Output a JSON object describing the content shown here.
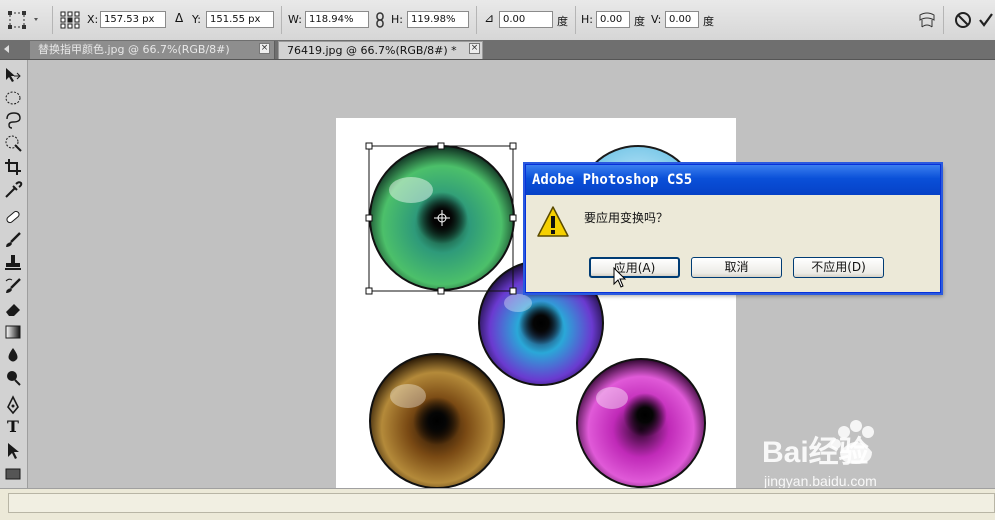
{
  "options": {
    "x_label": "X:",
    "x_value": "157.53 px",
    "y_label": "Y:",
    "y_value": "151.55 px",
    "w_label": "W:",
    "w_value": "118.94%",
    "h_label": "H:",
    "h_value": "119.98%",
    "angle_value": "0.00",
    "angle_unit": "度",
    "skew_h_label": "H:",
    "skew_h_value": "0.00",
    "skew_h_unit": "度",
    "skew_v_label": "V:",
    "skew_v_value": "0.00",
    "skew_v_unit": "度"
  },
  "tabs": [
    {
      "label": "替换指甲颜色.jpg @ 66.7%(RGB/8#)",
      "active": false
    },
    {
      "label": "76419.jpg @ 66.7%(RGB/8#) *",
      "active": true
    }
  ],
  "tools": [
    "move-tool",
    "marquee-tool",
    "lasso-tool",
    "quick-selection-tool",
    "crop-tool",
    "eyedropper-tool",
    "healing-brush-tool",
    "brush-tool",
    "clone-stamp-tool",
    "history-brush-tool",
    "eraser-tool",
    "gradient-tool",
    "blur-tool",
    "dodge-tool",
    "pen-tool",
    "type-tool",
    "path-selection-tool",
    "rectangle-tool"
  ],
  "dialog": {
    "title": "Adobe Photoshop CS5",
    "message": "要应用变换吗？",
    "buttons": {
      "apply": "应用(A)",
      "cancel": "取消",
      "dont_apply": "不应用(D)"
    }
  },
  "watermark": {
    "text": "Bai经验",
    "url": "jingyan.baidu.com"
  },
  "colors": {
    "dialog_title_bg": "#0a50d8",
    "dialog_bg": "#ece9d8",
    "eye_green": "#3aa26a",
    "eye_purple": "#5b3aa8",
    "eye_brown": "#8a5a1a",
    "eye_magenta": "#b02aa8"
  }
}
